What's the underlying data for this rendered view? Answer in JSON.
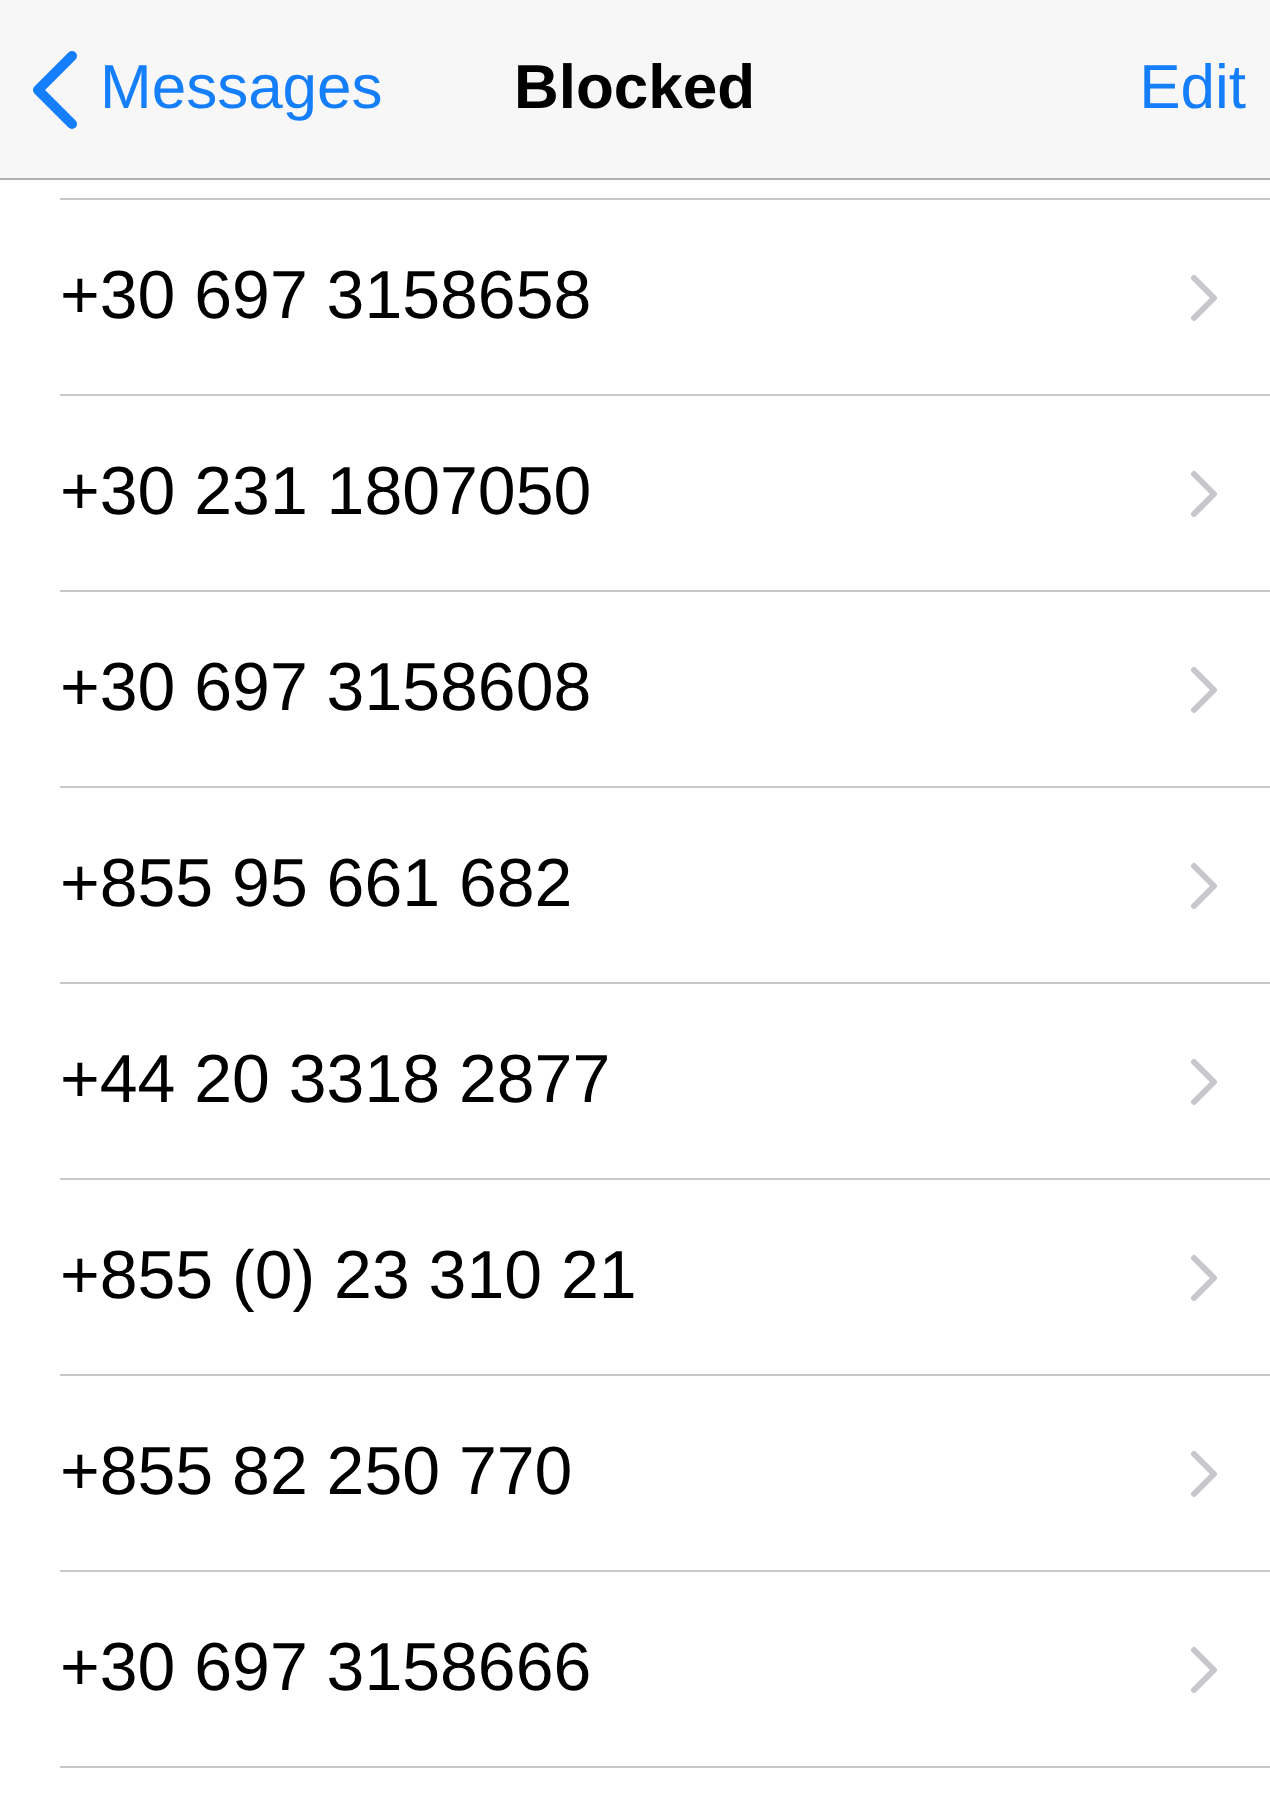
{
  "nav_bar": {
    "back_label": "Messages",
    "title": "Blocked",
    "action": "Edit"
  },
  "blocked_numbers": [
    "+30 697 3158658",
    "+30 231 1807050",
    "+30 697 3158608",
    "+855 95 661 682",
    "+44 20 3318 2877",
    "+855 (0) 23 310 21",
    "+855 82 250 770",
    "+30 697 3158666"
  ]
}
